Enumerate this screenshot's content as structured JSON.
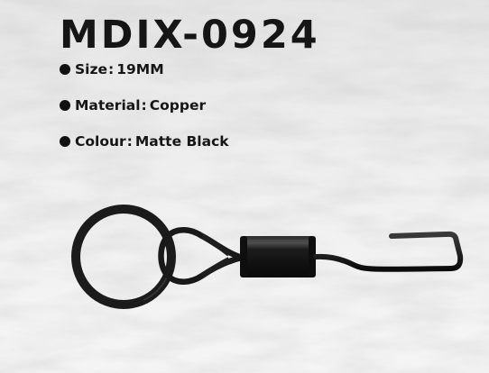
{
  "product": {
    "model": "MDIX-0924",
    "specs": [
      {
        "label": "Size",
        "separator": ":",
        "value": "19MM"
      },
      {
        "label": "Material",
        "separator": ":",
        "value": "Copper"
      },
      {
        "label": "Colour",
        "separator": ":",
        "value": "Matte Black"
      }
    ],
    "image_icon": "ring-swivel-hook-icon"
  },
  "colors": {
    "background": "#ececec",
    "text": "#151515",
    "metal": "#1a1a1a"
  }
}
